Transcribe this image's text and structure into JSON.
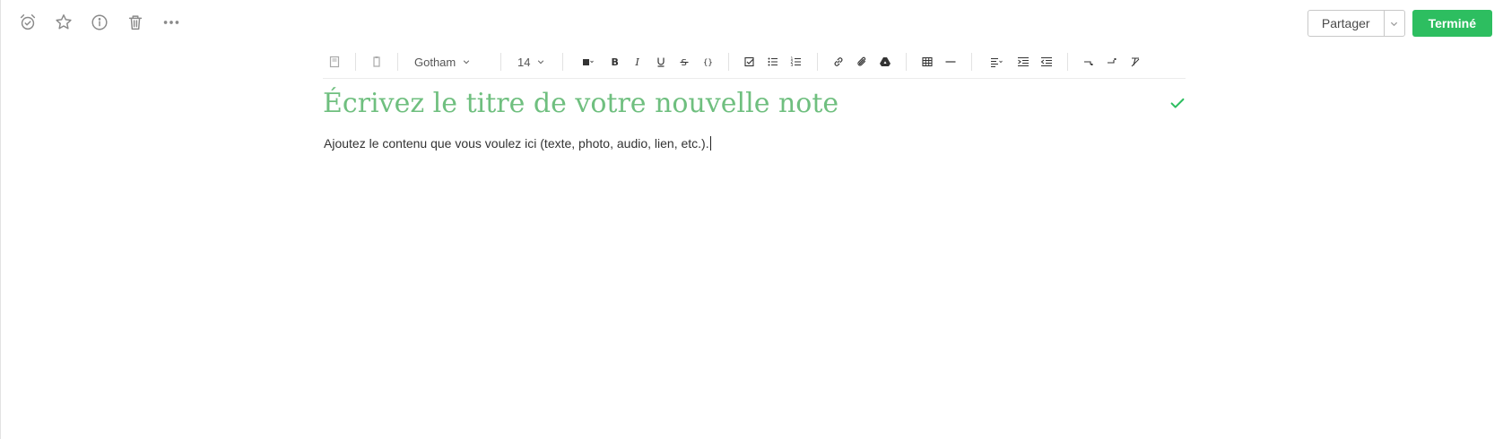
{
  "top_actions": {
    "icons": [
      "alarm-icon",
      "star-icon",
      "info-icon",
      "trash-icon",
      "more-icon"
    ]
  },
  "share": {
    "label": "Partager"
  },
  "done": {
    "label": "Terminé"
  },
  "toolbar": {
    "font": "Gotham",
    "size": "14"
  },
  "note": {
    "title_placeholder": "Écrivez le titre de votre nouvelle note",
    "body": "Ajoutez le contenu que vous voulez ici (texte, photo, audio, lien, etc.)."
  },
  "colors": {
    "accent": "#2dbe60",
    "title": "#6fbf7f",
    "icon": "#8a8a8a"
  }
}
